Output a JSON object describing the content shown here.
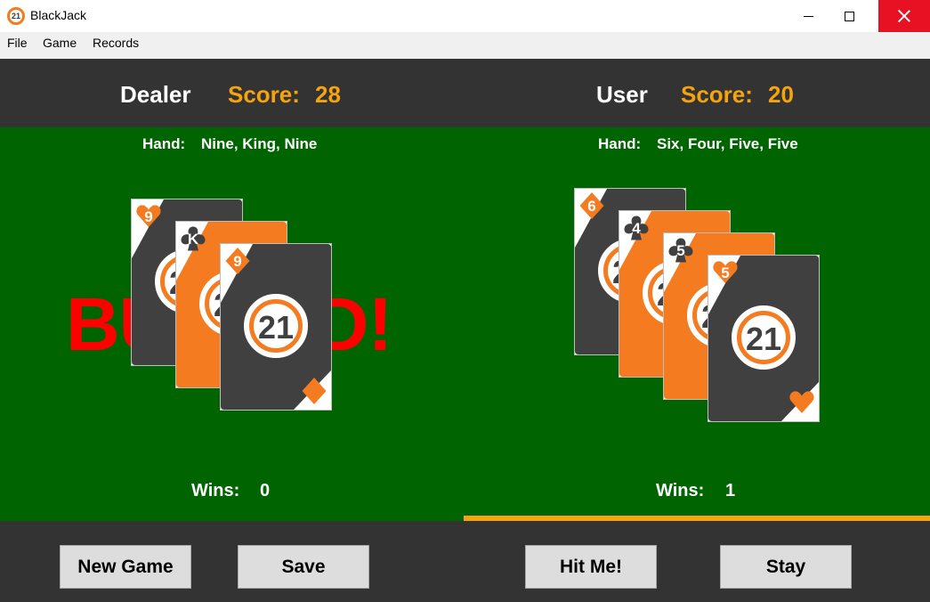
{
  "window": {
    "title": "BlackJack",
    "icon_text": "21",
    "icon_name": "blackjack-21-icon"
  },
  "menu": [
    "File",
    "Game",
    "Records"
  ],
  "dealer": {
    "name": "Dealer",
    "score_label": "Score:",
    "score": "28",
    "hand_label": "Hand:",
    "hand": "Nine, King, Nine",
    "wins_label": "Wins:",
    "wins": "0",
    "status": "BUSTED!",
    "cards": [
      {
        "rank": "9",
        "suit": "heart",
        "back": "dark"
      },
      {
        "rank": "K",
        "suit": "club",
        "back": "orange"
      },
      {
        "rank": "9",
        "suit": "diamond",
        "back": "dark"
      }
    ]
  },
  "user": {
    "name": "User",
    "score_label": "Score:",
    "score": "20",
    "hand_label": "Hand:",
    "hand": "Six, Four, Five, Five",
    "wins_label": "Wins:",
    "wins": "1",
    "cards": [
      {
        "rank": "6",
        "suit": "diamond",
        "back": "dark"
      },
      {
        "rank": "4",
        "suit": "club",
        "back": "orange"
      },
      {
        "rank": "5",
        "suit": "club",
        "back": "orange"
      },
      {
        "rank": "5",
        "suit": "heart",
        "back": "dark"
      }
    ]
  },
  "card_logo_text": "21",
  "buttons": {
    "new_game": "New Game",
    "save": "Save",
    "hit": "Hit Me!",
    "stay": "Stay"
  },
  "colors": {
    "felt": "#006400",
    "panel": "#333333",
    "accent": "#f5a40d",
    "card_orange": "#f47b20",
    "card_dark": "#404040",
    "busted": "#ff0000"
  }
}
